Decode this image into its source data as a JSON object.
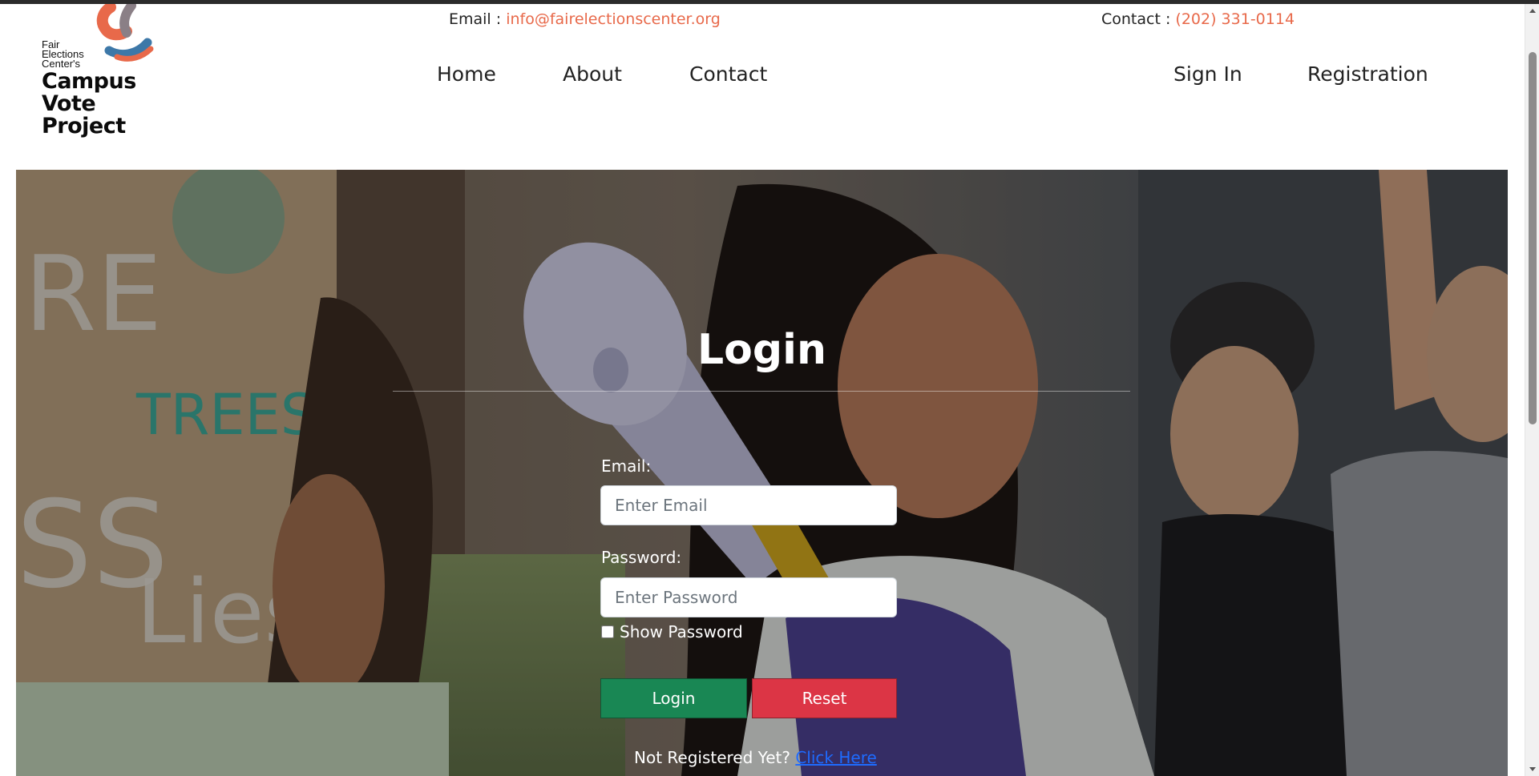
{
  "header": {
    "logo": {
      "line1": "Fair",
      "line2": "Elections",
      "line3": "Center's",
      "name1": "Campus",
      "name2": "Vote",
      "name3": "Project"
    },
    "email_label": "Email :",
    "email_value": "info@fairelectionscenter.org",
    "contact_label": "Contact :",
    "contact_value": "(202) 331-0114",
    "accent_color": "#e8694a"
  },
  "nav": {
    "home": "Home",
    "about": "About",
    "contact": "Contact",
    "sign_in": "Sign In",
    "registration": "Registration"
  },
  "login_form": {
    "title": "Login",
    "email_label": "Email:",
    "email_placeholder": "Enter Email",
    "password_label": "Password:",
    "password_placeholder": "Enter Password",
    "show_password_label": "Show Password",
    "show_password_checked": false,
    "login_button": "Login",
    "reset_button": "Reset",
    "not_registered_text": "Not Registered Yet?",
    "click_here_link": "Click Here",
    "login_button_color": "#198754",
    "reset_button_color": "#dc3545"
  }
}
